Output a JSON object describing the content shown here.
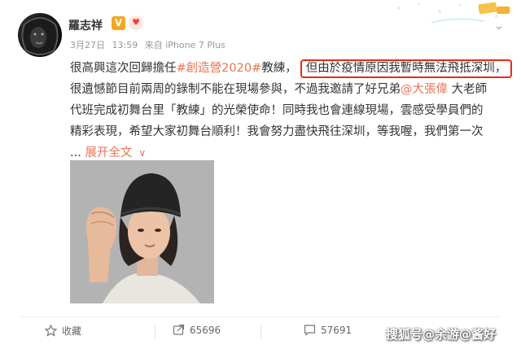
{
  "author": {
    "name": "羅志祥",
    "verified_badge": "V"
  },
  "meta": {
    "date": "3月27日",
    "time": "13:59",
    "source": "来自 iPhone 7 Plus"
  },
  "post": {
    "line1_pre": "很高興這次回歸擔任",
    "line1_tag": "#創造營2020#",
    "line1_mid": "教練，",
    "line1_highlight": "但由於疫情原因我暫時無法飛抵深圳，",
    "line2_pre": "很遺憾節目前兩周的錄制不能在現場參與，不過我邀請了好兄弟",
    "line2_mention": "@大張偉",
    "line2_post": " 大老師",
    "line3": "代班完成初舞台里「教練」的光榮使命！同時我也會連線現場，雲感受學員們的",
    "line4": "精彩表現，希望大家初舞台順利！我會努力盡快飛往深圳，等我喔，我們第一次",
    "line5_ellipsis": "... ",
    "line5_expand": "展开全文",
    "expand_chevron": "∨"
  },
  "actions": {
    "favorite_label": "收藏",
    "repost_count": "65696",
    "comment_count": "57691"
  },
  "watermark": "搜狐号@余游@酱好",
  "colors": {
    "link": "#eb7350",
    "highlight_border": "#e5291e",
    "verified": "#f5a623"
  }
}
